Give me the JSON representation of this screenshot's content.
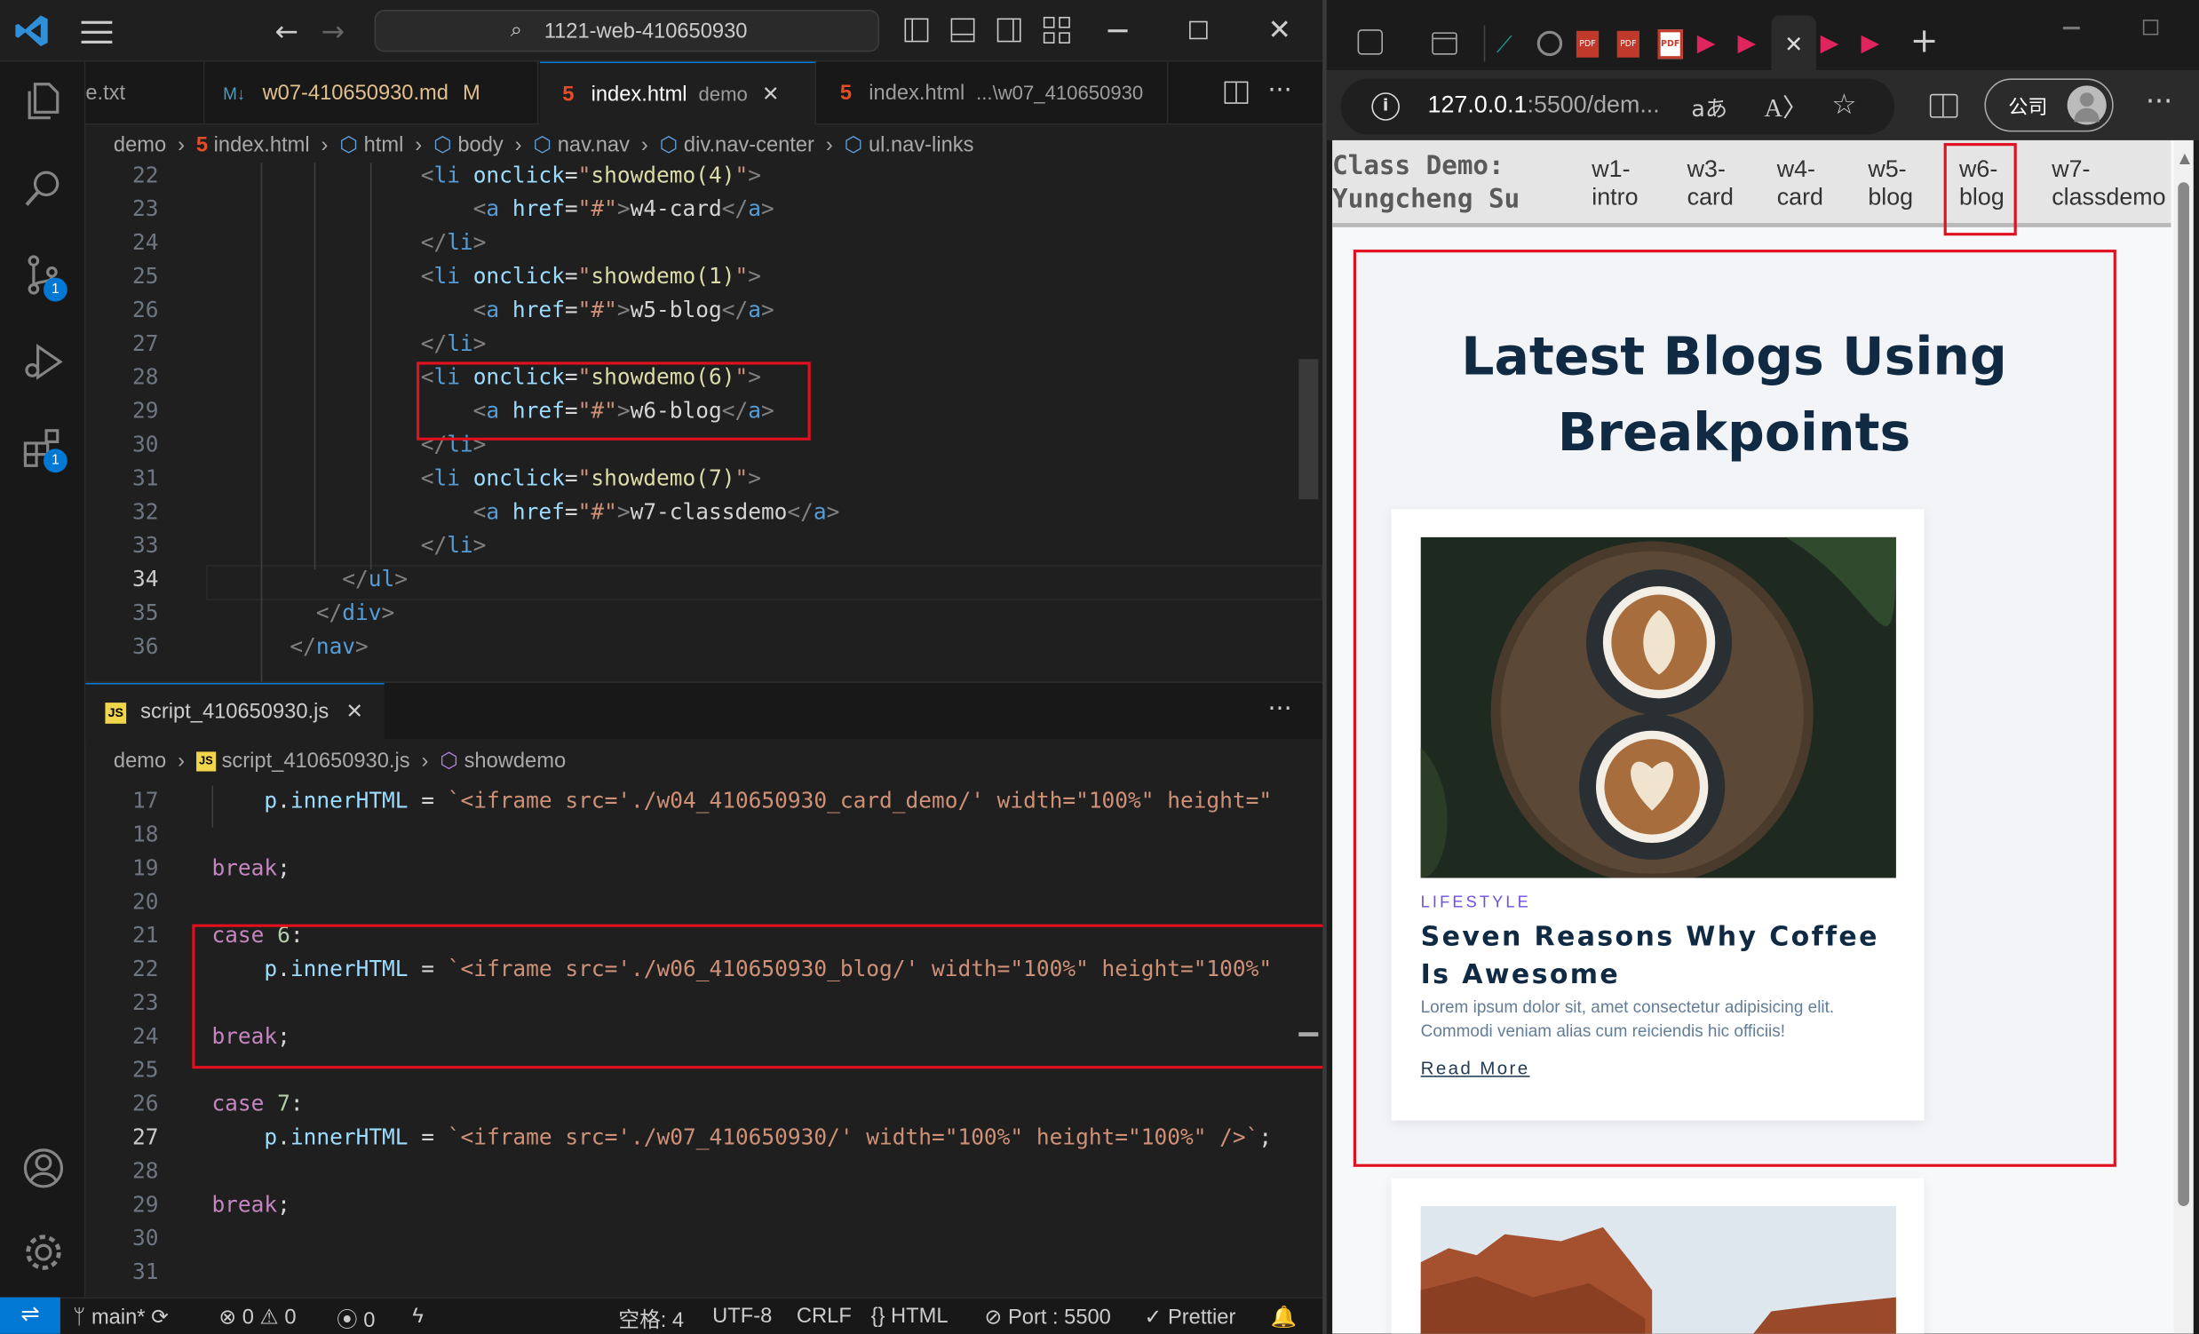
{
  "vscode": {
    "search": "1121-web-410650930",
    "tabs": [
      {
        "label": "e.txt",
        "badge": ""
      },
      {
        "label": "w07-410650930.md",
        "badge": "M"
      },
      {
        "label": "index.html",
        "badge": "demo"
      },
      {
        "label": "index.html",
        "badge": "...\\w07_410650930"
      }
    ],
    "breadcrumb_top": [
      "demo",
      "index.html",
      "html",
      "body",
      "nav.nav",
      "div.nav-center",
      "ul.nav-links"
    ],
    "editor_top": {
      "lines": [
        {
          "n": "22",
          "indent": "    ",
          "kind": "li-open",
          "attr": "onclick",
          "val": "showdemo(4)"
        },
        {
          "n": "23",
          "indent": "        ",
          "kind": "a",
          "href": "#",
          "text": "w4-card"
        },
        {
          "n": "24",
          "indent": "    ",
          "kind": "li-close"
        },
        {
          "n": "25",
          "indent": "    ",
          "kind": "li-open",
          "attr": "onclick",
          "val": "showdemo(1)"
        },
        {
          "n": "26",
          "indent": "        ",
          "kind": "a",
          "href": "#",
          "text": "w5-blog"
        },
        {
          "n": "27",
          "indent": "    ",
          "kind": "li-close"
        },
        {
          "n": "28",
          "indent": "    ",
          "kind": "li-open",
          "attr": "onclick",
          "val": "showdemo(6)"
        },
        {
          "n": "29",
          "indent": "        ",
          "kind": "a",
          "href": "#",
          "text": "w6-blog"
        },
        {
          "n": "30",
          "indent": "    ",
          "kind": "li-close"
        },
        {
          "n": "31",
          "indent": "    ",
          "kind": "li-open",
          "attr": "onclick",
          "val": "showdemo(7)"
        },
        {
          "n": "32",
          "indent": "        ",
          "kind": "a",
          "href": "#",
          "text": "w7-classdemo"
        },
        {
          "n": "33",
          "indent": "    ",
          "kind": "li-close"
        },
        {
          "n": "34",
          "indent": "",
          "kind": "close",
          "text": "ul"
        },
        {
          "n": "35",
          "indent": "",
          "kind": "close",
          "text": "div"
        },
        {
          "n": "36",
          "indent": "",
          "kind": "close",
          "text": "nav"
        }
      ]
    },
    "panel_tab": "script_410650930.js",
    "breadcrumb_bottom": [
      "demo",
      "script_410650930.js",
      "showdemo"
    ],
    "editor_bottom": {
      "lines": [
        {
          "n": "17",
          "code": [
            [
              "    ",
              ""
            ],
            [
              "p",
              "t-var"
            ],
            [
              ".",
              ""
            ],
            [
              "innerHTML",
              "t-var"
            ],
            [
              " = ",
              ""
            ],
            [
              "`<iframe src='./w04_410650930_card_demo/' width=\"100%\" height=\"",
              "t-str"
            ]
          ]
        },
        {
          "n": "18",
          "code": []
        },
        {
          "n": "19",
          "code": [
            [
              "break",
              "t-kw"
            ],
            [
              ";",
              "t-txt"
            ]
          ]
        },
        {
          "n": "20",
          "code": []
        },
        {
          "n": "21",
          "code": [
            [
              "case ",
              "t-kw"
            ],
            [
              "6",
              "t-num"
            ],
            [
              ":",
              "t-txt"
            ]
          ]
        },
        {
          "n": "22",
          "code": [
            [
              "    ",
              ""
            ],
            [
              "p",
              "t-var"
            ],
            [
              ".",
              ""
            ],
            [
              "innerHTML",
              "t-var"
            ],
            [
              " = ",
              ""
            ],
            [
              "`<iframe src='./w06_410650930_blog/' width=\"100%\" height=\"100%\"",
              "t-str"
            ]
          ]
        },
        {
          "n": "23",
          "code": []
        },
        {
          "n": "24",
          "code": [
            [
              "break",
              "t-kw"
            ],
            [
              ";",
              "t-txt"
            ]
          ]
        },
        {
          "n": "25",
          "code": []
        },
        {
          "n": "26",
          "code": [
            [
              "case ",
              "t-kw"
            ],
            [
              "7",
              "t-num"
            ],
            [
              ":",
              "t-txt"
            ]
          ]
        },
        {
          "n": "27",
          "code": [
            [
              "    ",
              ""
            ],
            [
              "p",
              "t-var"
            ],
            [
              ".",
              ""
            ],
            [
              "innerHTML",
              "t-var"
            ],
            [
              " = ",
              ""
            ],
            [
              "`<iframe src='./w07_410650930/' width=\"100%\" height=\"100%\" />`",
              "t-str"
            ],
            [
              ";",
              "t-txt"
            ]
          ]
        },
        {
          "n": "28",
          "code": []
        },
        {
          "n": "29",
          "code": [
            [
              "break",
              "t-kw"
            ],
            [
              ";",
              "t-txt"
            ]
          ]
        },
        {
          "n": "30",
          "code": []
        },
        {
          "n": "31",
          "code": []
        }
      ]
    },
    "status": {
      "branch": "main*",
      "errors": "0",
      "warnings": "0",
      "ports": "0",
      "spaces": "空格: 4",
      "encoding": "UTF-8",
      "eol": "CRLF",
      "language": "HTML",
      "port": "Port : 5500",
      "formatter": "Prettier"
    },
    "badges": {
      "scm": "1",
      "extensions": "1"
    }
  },
  "browser": {
    "url": "127.0.0.1:5500/dem...",
    "url_host": "127.0.0.1",
    "url_rest": ":5500/dem...",
    "profile": "公司",
    "demo_title_1": "Class Demo:",
    "demo_title_2": "Yungcheng Su",
    "nav": [
      [
        "w1-",
        "intro"
      ],
      [
        "w3-",
        "card"
      ],
      [
        "w4-",
        "card"
      ],
      [
        "w5-",
        "blog"
      ],
      [
        "w6-",
        "blog"
      ],
      [
        "w7-",
        "classdemo"
      ]
    ],
    "blog": {
      "heading_1": "Latest Blogs Using",
      "heading_2": "Breakpoints",
      "card": {
        "category": "LIFESTYLE",
        "title_1": "Seven Reasons Why Coffee",
        "title_2": "Is Awesome",
        "text_1": "Lorem ipsum dolor sit, amet consectetur adipisicing elit.",
        "text_2": "Commodi veniam alias cum reiciendis hic officiis!",
        "link": "Read More"
      }
    }
  },
  "colors": {
    "accent": "#0078d4",
    "highlight": "#e0101e",
    "blog_category": "#6f4ee0"
  }
}
